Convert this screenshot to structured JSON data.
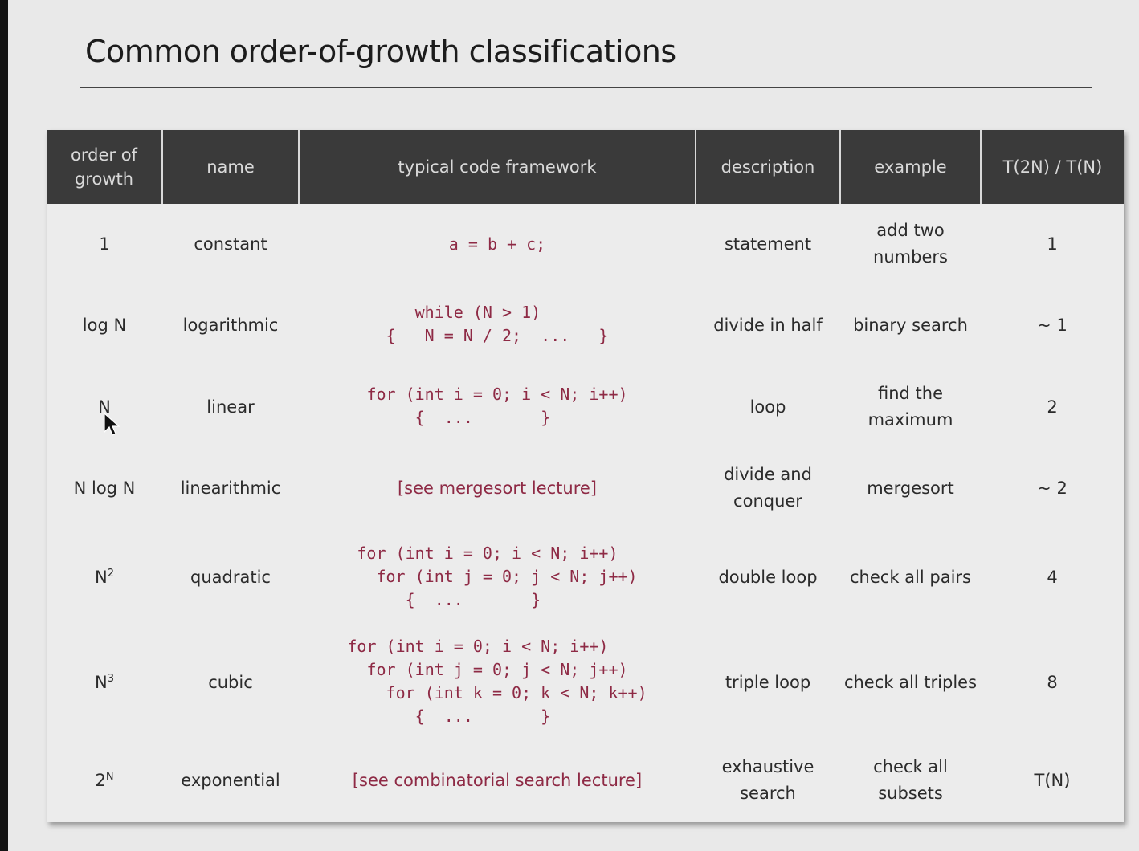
{
  "slide": {
    "title": "Common order-of-growth classifications"
  },
  "table": {
    "headers": [
      "order of growth",
      "name",
      "typical code framework",
      "description",
      "example",
      "T(2N) / T(N)"
    ],
    "rows": [
      {
        "order": {
          "base": "1",
          "exp": ""
        },
        "name": "constant",
        "code": "a = b + c;",
        "code_is_ref": false,
        "description": "statement",
        "example": "add two numbers",
        "ratio": "1"
      },
      {
        "order": {
          "base": "log N",
          "exp": ""
        },
        "name": "logarithmic",
        "code": "   while (N > 1)\n{   N = N / 2;  ...   }",
        "code_is_ref": false,
        "description": "divide in half",
        "example": "binary search",
        "ratio": "~ 1"
      },
      {
        "order": {
          "base": "N",
          "exp": ""
        },
        "name": "linear",
        "code": "for (int i = 0; i < N; i++)\n     {  ...       }",
        "code_is_ref": false,
        "description": "loop",
        "example": "find the maximum",
        "ratio": "2"
      },
      {
        "order": {
          "base": "N log N",
          "exp": ""
        },
        "name": "linearithmic",
        "code": "[see mergesort lecture]",
        "code_is_ref": true,
        "description": "divide and conquer",
        "example": "mergesort",
        "ratio": "~ 2"
      },
      {
        "order": {
          "base": "N",
          "exp": "2"
        },
        "name": "quadratic",
        "code": "for (int i = 0; i < N; i++)\n  for (int j = 0; j < N; j++)\n     {  ...       }",
        "code_is_ref": false,
        "description": "double loop",
        "example": "check all pairs",
        "ratio": "4"
      },
      {
        "order": {
          "base": "N",
          "exp": "3"
        },
        "name": "cubic",
        "code": "for (int i = 0; i < N; i++)\n  for (int j = 0; j < N; j++)\n    for (int k = 0; k < N; k++)\n       {  ...       }",
        "code_is_ref": false,
        "description": "triple loop",
        "example": "check all triples",
        "ratio": "8"
      },
      {
        "order": {
          "base": "2",
          "exp": "N"
        },
        "name": "exponential",
        "code": "[see combinatorial search lecture]",
        "code_is_ref": true,
        "description": "exhaustive search",
        "example": "check all subsets",
        "ratio": "T(N)"
      }
    ]
  },
  "colors": {
    "header_bg": "#3a3a3a",
    "header_text": "#d9d9d9",
    "code_text": "#8e2a45",
    "slide_bg": "#e9e9e9"
  },
  "icons": {
    "cursor": "mouse-pointer-icon"
  }
}
